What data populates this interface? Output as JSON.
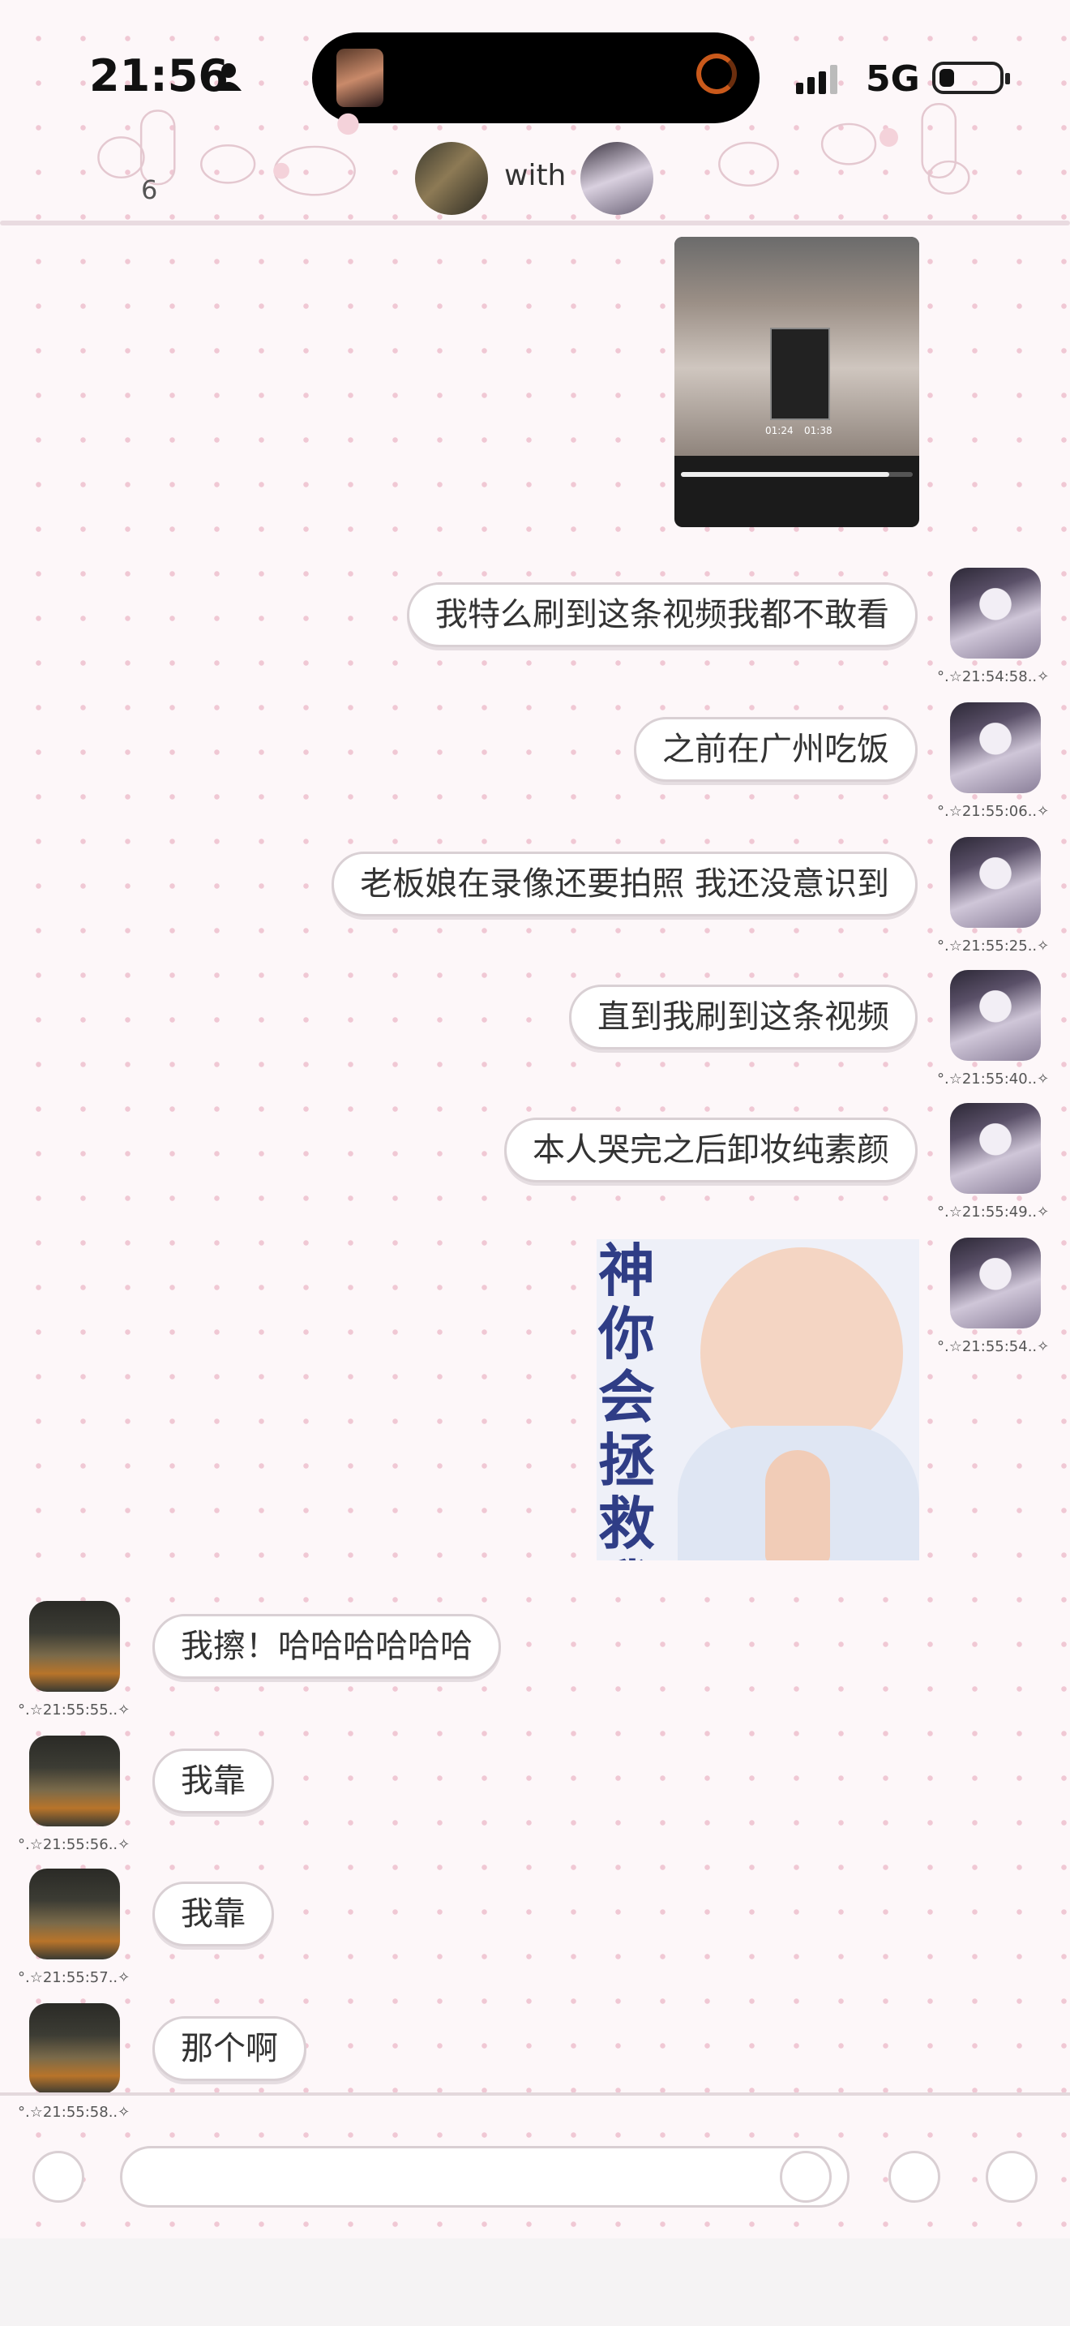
{
  "status_bar": {
    "time": "21:56",
    "network": "5G"
  },
  "header": {
    "unread_count": "6",
    "title": "with"
  },
  "video_message": {
    "time_current": "01:24",
    "time_total": "01:38",
    "progress": 0.9
  },
  "messages_right": [
    {
      "text": "我特么刷到这条视频我都不敢看",
      "stamp": "°.☆21:54:58..✧"
    },
    {
      "text": "之前在广州吃饭",
      "stamp": "°.☆21:55:06..✧"
    },
    {
      "text": "老板娘在录像还要拍照 我还没意识到",
      "stamp": "°.☆21:55:25..✧"
    },
    {
      "text": "直到我刷到这条视频",
      "stamp": "°.☆21:55:40..✧"
    },
    {
      "text": "本人哭完之后卸妆纯素颜",
      "stamp": "°.☆21:55:49..✧"
    }
  ],
  "sticker": {
    "text": "神你会拯救我吗",
    "stamp": "°.☆21:55:54..✧"
  },
  "messages_left": [
    {
      "text": "我擦！哈哈哈哈哈哈",
      "stamp": "°.☆21:55:55..✧"
    },
    {
      "text": "我靠",
      "stamp": "°.☆21:55:56..✧"
    },
    {
      "text": "我靠",
      "stamp": "°.☆21:55:57..✧"
    },
    {
      "text": "那个啊",
      "stamp": "°.☆21:55:58..✧"
    }
  ],
  "colors": {
    "accent_pink": "#f0c8d4",
    "bubble_border": "#d9d0d4",
    "sticker_text": "#2f3d86"
  }
}
